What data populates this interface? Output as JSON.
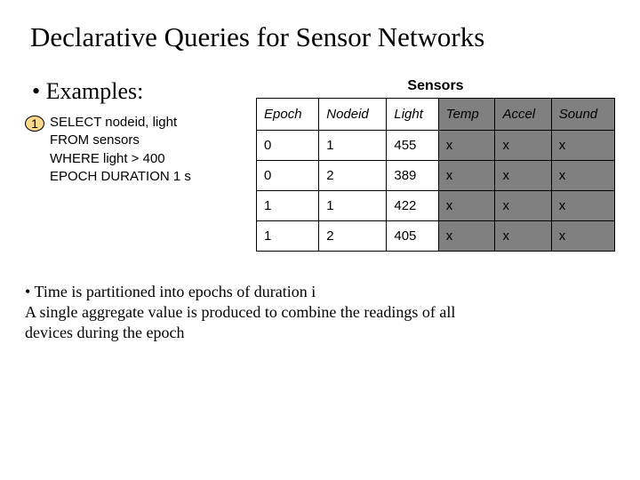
{
  "title": "Declarative Queries for Sensor Networks",
  "examples_heading": "• Examples:",
  "query_marker": "1",
  "query_lines": {
    "l0": "SELECT nodeid, light",
    "l1": "FROM sensors",
    "l2": "WHERE light > 400",
    "l3": "EPOCH DURATION 1 s"
  },
  "table_caption": "Sensors",
  "headers": {
    "h0": "Epoch",
    "h1": "Nodeid",
    "h2": "Light",
    "h3": "Temp",
    "h4": "Accel",
    "h5": "Sound"
  },
  "rows": [
    {
      "c0": "0",
      "c1": "1",
      "c2": "455",
      "c3": "x",
      "c4": "x",
      "c5": "x"
    },
    {
      "c0": "0",
      "c1": "2",
      "c2": "389",
      "c3": "x",
      "c4": "x",
      "c5": "x"
    },
    {
      "c0": "1",
      "c1": "1",
      "c2": "422",
      "c3": "x",
      "c4": "x",
      "c5": "x"
    },
    {
      "c0": "1",
      "c1": "2",
      "c2": "405",
      "c3": "x",
      "c4": "x",
      "c5": "x"
    }
  ],
  "footer": {
    "line0": "• Time is partitioned into epochs of duration i",
    "line1": "A single aggregate value is produced to combine the readings of all",
    "line2": "devices during the epoch"
  },
  "chart_data": {
    "type": "table",
    "title": "Sensors",
    "columns": [
      "Epoch",
      "Nodeid",
      "Light",
      "Temp",
      "Accel",
      "Sound"
    ],
    "visible_columns": [
      "Epoch",
      "Nodeid",
      "Light"
    ],
    "hidden_columns": [
      "Temp",
      "Accel",
      "Sound"
    ],
    "rows": [
      {
        "Epoch": 0,
        "Nodeid": 1,
        "Light": 455,
        "Temp": "x",
        "Accel": "x",
        "Sound": "x"
      },
      {
        "Epoch": 0,
        "Nodeid": 2,
        "Light": 389,
        "Temp": "x",
        "Accel": "x",
        "Sound": "x"
      },
      {
        "Epoch": 1,
        "Nodeid": 1,
        "Light": 422,
        "Temp": "x",
        "Accel": "x",
        "Sound": "x"
      },
      {
        "Epoch": 1,
        "Nodeid": 2,
        "Light": 405,
        "Temp": "x",
        "Accel": "x",
        "Sound": "x"
      }
    ]
  }
}
